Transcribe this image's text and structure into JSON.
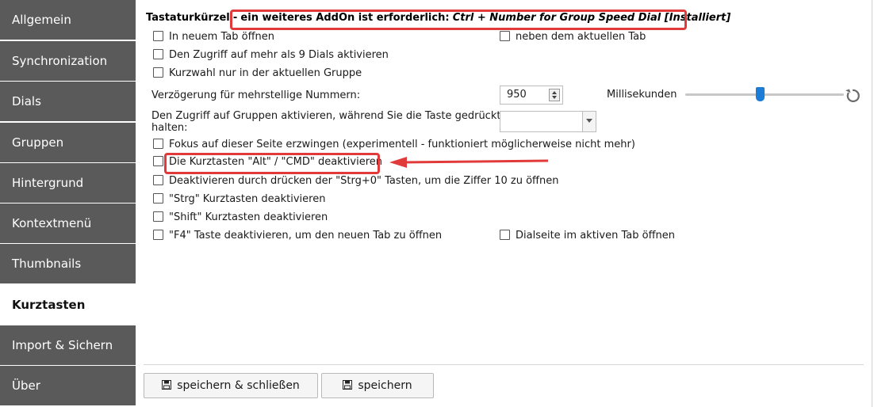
{
  "sidebar": {
    "items": [
      {
        "label": "Allgemein"
      },
      {
        "label": "Synchronization"
      },
      {
        "label": "Dials"
      },
      {
        "label": "Gruppen"
      },
      {
        "label": "Hintergrund"
      },
      {
        "label": "Kontextmenü"
      },
      {
        "label": "Thumbnails"
      },
      {
        "label": "Kurztasten",
        "active": true
      },
      {
        "label": "Import & Sichern"
      },
      {
        "label": "Über"
      }
    ]
  },
  "header": {
    "label": "Tastaturkürzel",
    "dash": "-",
    "requirement": "ein weiteres AddOn ist erforderlich:",
    "addon": "Ctrl + Number for Group Speed Dial [Installiert]"
  },
  "options": {
    "new_tab": "In neuem Tab öffnen",
    "next_to_tab": "neben dem aktuellen Tab",
    "more_than_9": "Den Zugriff auf mehr als 9 Dials aktivieren",
    "current_group": "Kurzwahl nur in der aktuellen Gruppe",
    "delay_label": "Verzögerung für mehrstellige Nummern:",
    "delay_value": "950",
    "delay_unit": "Millisekunden",
    "delay_slider_fraction": 0.47,
    "group_access_label_1": "Den Zugriff auf Gruppen aktivieren, während Sie die Taste gedrückt",
    "group_access_label_2": "halten:",
    "group_access_value": "",
    "force_focus": "Fokus auf dieser Seite erzwingen (experimentell - funktioniert möglicherweise nicht mehr)",
    "disable_alt_cmd": "Die Kurztasten \"Alt\" / \"CMD\" deaktivieren",
    "disable_ctrl0": "Deaktivieren durch drücken der \"Strg+0\" Tasten, um die Ziffer 10 zu öffnen",
    "disable_strg": "\"Strg\" Kurztasten deaktivieren",
    "disable_shift": "\"Shift\" Kurztasten deaktivieren",
    "disable_f4": "\"F4\" Taste deaktivieren, um den neuen Tab zu öffnen",
    "dial_active_tab": "Dialseite im aktiven Tab öffnen"
  },
  "footer": {
    "save_close": "speichern & schließen",
    "save": "speichern"
  },
  "colors": {
    "sidebar_bg": "#5a5a5a",
    "highlight": "#e03a3a",
    "slider": "#1c7cd6"
  },
  "icons": {
    "save": "floppy-disk-icon",
    "reset": "reset-icon",
    "checkbox": "checkbox-icon",
    "spinner": "spinner-arrows-icon",
    "dropdown": "chevron-down-icon"
  }
}
